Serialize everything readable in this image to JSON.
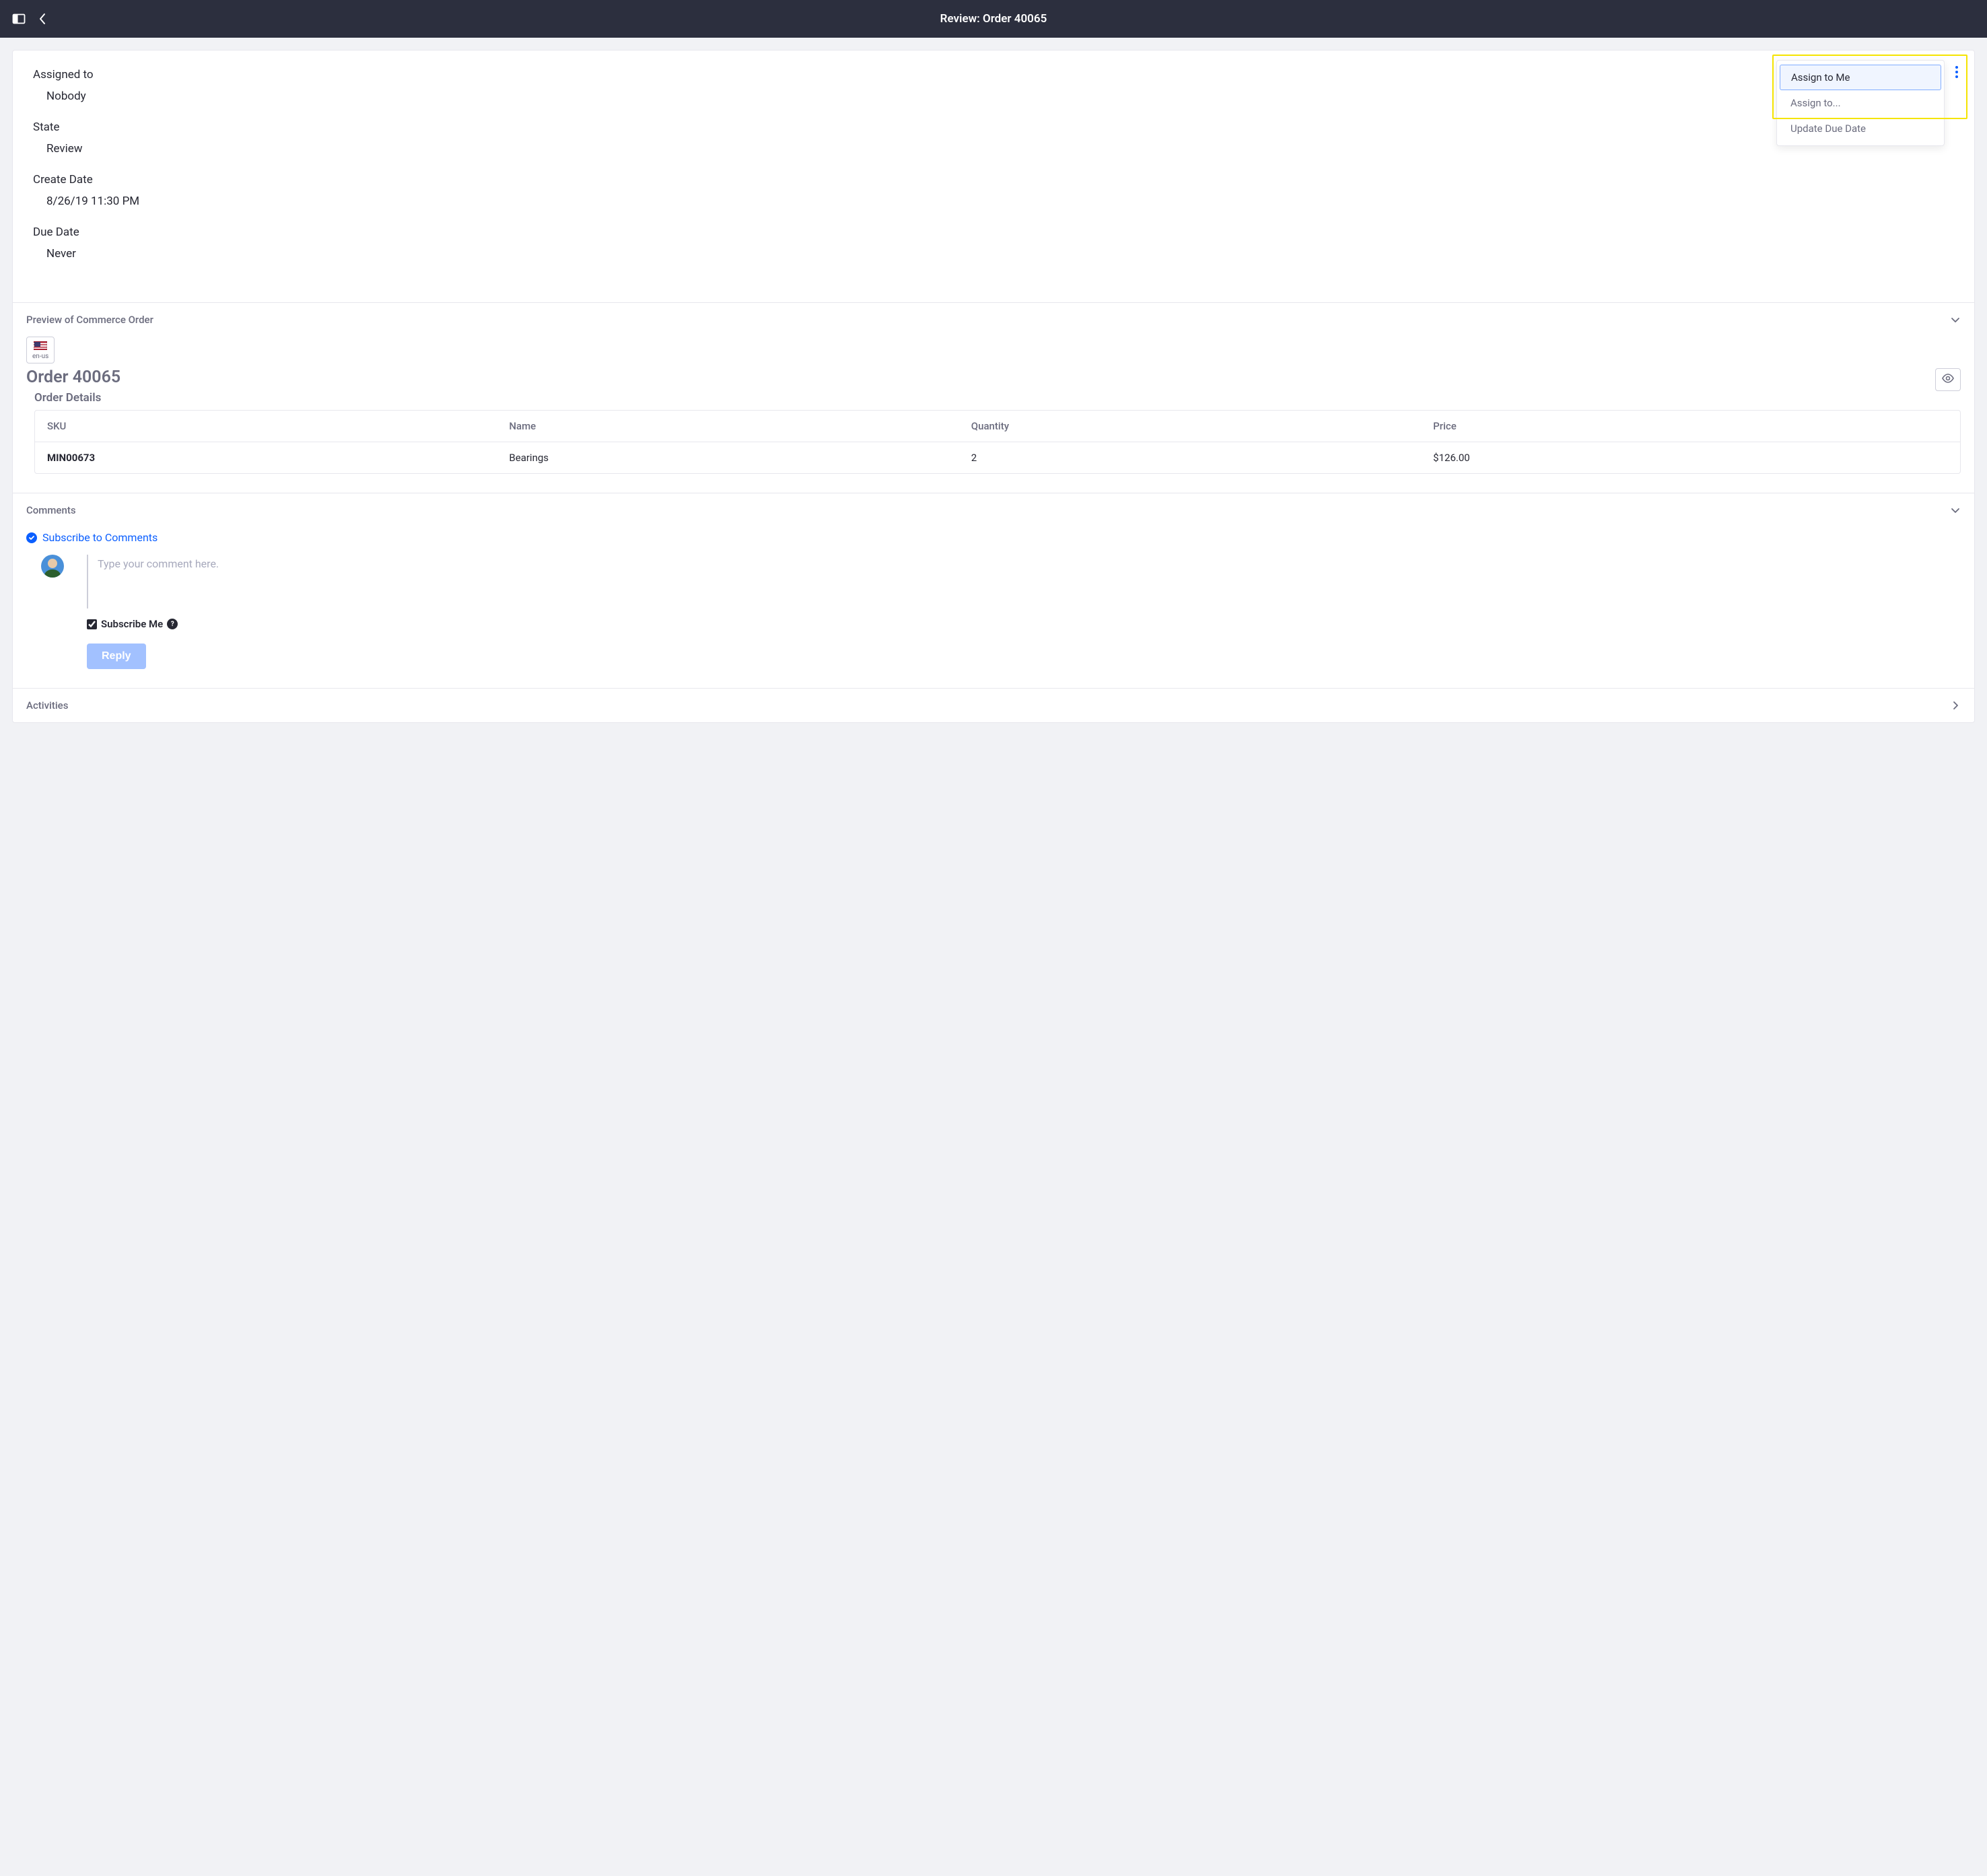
{
  "header": {
    "title": "Review: Order 40065"
  },
  "details": {
    "assigned_to": {
      "label": "Assigned to",
      "value": "Nobody"
    },
    "state": {
      "label": "State",
      "value": "Review"
    },
    "create_date": {
      "label": "Create Date",
      "value": "8/26/19 11:30 PM"
    },
    "due_date": {
      "label": "Due Date",
      "value": "Never"
    }
  },
  "actions_menu": {
    "assign_to_me": "Assign to Me",
    "assign_to": "Assign to...",
    "update_due_date": "Update Due Date"
  },
  "preview": {
    "section_title": "Preview of Commerce Order",
    "locale": "en-us",
    "order_heading": "Order 40065",
    "details_heading": "Order Details",
    "columns": {
      "sku": "SKU",
      "name": "Name",
      "quantity": "Quantity",
      "price": "Price"
    },
    "rows": [
      {
        "sku": "MIN00673",
        "name": "Bearings",
        "quantity": "2",
        "price": "$126.00"
      }
    ]
  },
  "comments": {
    "section_title": "Comments",
    "subscribe_label": "Subscribe to Comments",
    "input_placeholder": "Type your comment here.",
    "subscribe_me_label": "Subscribe Me",
    "subscribe_me_checked": true,
    "reply_label": "Reply"
  },
  "activities": {
    "section_title": "Activities"
  }
}
